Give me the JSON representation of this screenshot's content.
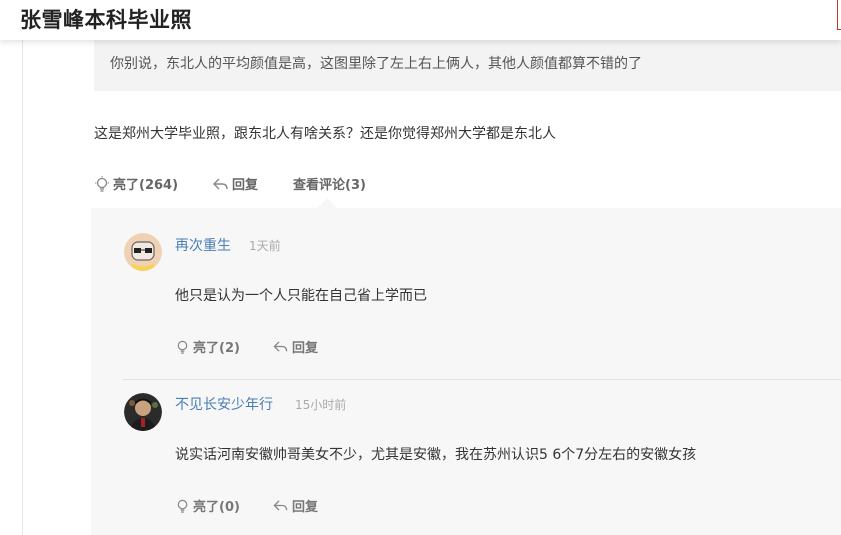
{
  "header": {
    "title": "张雪峰本科毕业照"
  },
  "quote": {
    "text": "你别说，东北人的平均颜值是高，这图里除了左上右上俩人，其他人颜值都算不错的了"
  },
  "comment": {
    "text": "这是郑州大学毕业照，跟东北人有啥关系？还是你觉得郑州大学都是东北人",
    "like_label": "亮了(264)",
    "reply_label": "回复",
    "view_comments_label": "查看评论(3)"
  },
  "replies": [
    {
      "user": "再次重生",
      "time": "1天前",
      "text": "他只是认为一个人只能在自己省上学而已",
      "like_label": "亮了(2)",
      "reply_label": "回复"
    },
    {
      "user": "不见长安少年行",
      "time": "15小时前",
      "text": "说实话河南安徽帅哥美女不少，尤其是安徽，我在苏州认识5  6个7分左右的安徽女孩",
      "like_label": "亮了(0)",
      "reply_label": "回复"
    }
  ],
  "colors": {
    "link_blue": "#4a7fb5",
    "panel_bg": "#f7f7f8",
    "quote_bg": "#f3f3f4"
  }
}
